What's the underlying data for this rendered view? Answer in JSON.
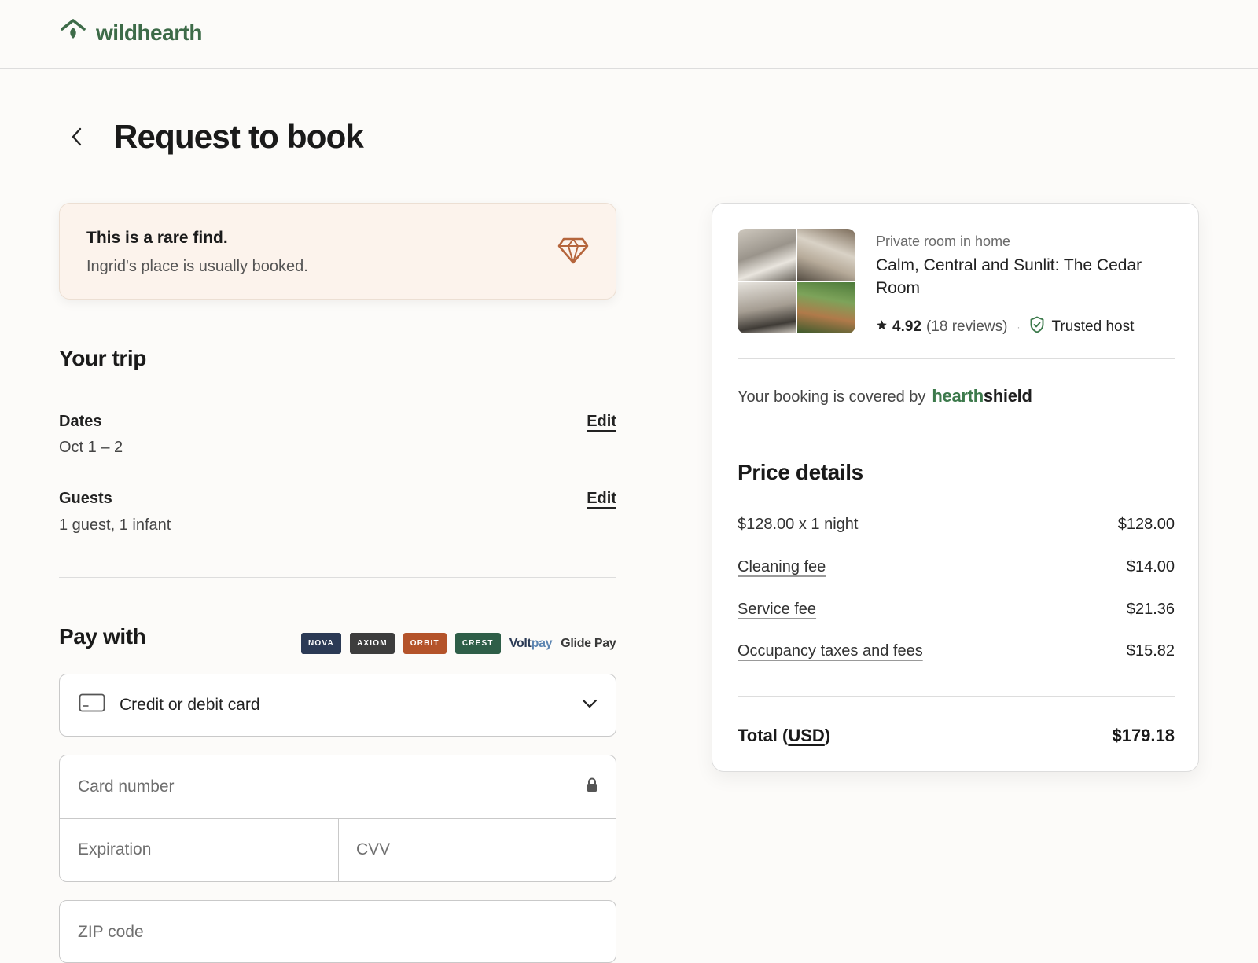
{
  "brand": {
    "name": "wildhearth"
  },
  "page": {
    "title": "Request to book"
  },
  "rare": {
    "title": "This is a rare find.",
    "subtitle": "Ingrid's place is usually booked.",
    "icon": "diamond-icon"
  },
  "trip": {
    "title": "Your trip",
    "dates": {
      "label": "Dates",
      "value": "Oct 1 – 2",
      "edit": "Edit"
    },
    "guests": {
      "label": "Guests",
      "value": "1 guest, 1 infant",
      "edit": "Edit"
    }
  },
  "pay": {
    "title": "Pay with",
    "logos": [
      {
        "text": "NOVA",
        "color": "#2b3a55"
      },
      {
        "text": "AXIOM",
        "color": "#3d3d3d"
      },
      {
        "text": "ORBIT",
        "color": "#b4532a"
      },
      {
        "text": "CREST",
        "color": "#2e5e48"
      }
    ],
    "voltpay": {
      "a": "Volt",
      "b": "pay"
    },
    "glidepay": "Glide Pay",
    "method": "Credit or debit card",
    "card_number_placeholder": "Card number",
    "expiration_placeholder": "Expiration",
    "cvv_placeholder": "CVV",
    "zip_placeholder": "ZIP code"
  },
  "listing": {
    "type": "Private room in home",
    "name": "Calm, Central and Sunlit: The Cedar Room",
    "rating": "4.92",
    "reviews": "(18 reviews)",
    "separator": "·",
    "host_badge": "Trusted host",
    "coverage_text": "Your booking is covered by",
    "coverage_brand_a": "hearth",
    "coverage_brand_b": "shield"
  },
  "price": {
    "title": "Price details",
    "rows": [
      {
        "label": "$128.00 x 1 night",
        "amount": "$128.00"
      },
      {
        "label": "Cleaning fee",
        "amount": "$14.00"
      },
      {
        "label": "Service fee",
        "amount": "$21.36"
      },
      {
        "label": "Occupancy taxes and fees",
        "amount": "$15.82"
      }
    ],
    "total_label": "Total (",
    "total_currency": "USD",
    "total_label_end": ")",
    "total_amount": "$179.18"
  },
  "colors": {
    "brand_green": "#3d6b48",
    "rare_icon": "#b5653c",
    "background": "#fcfbf9"
  }
}
